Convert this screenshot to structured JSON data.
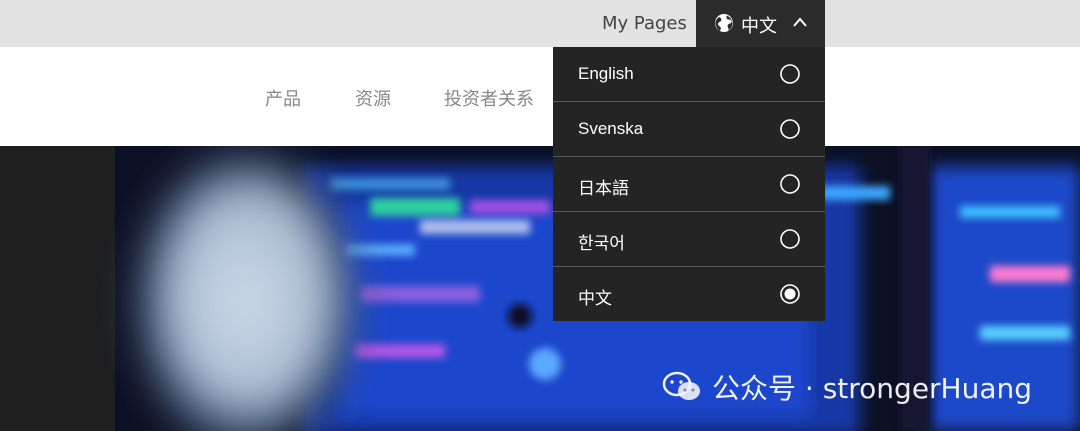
{
  "topbar": {
    "my_pages": "My Pages",
    "language_current": "中文"
  },
  "nav": {
    "items": [
      "产品",
      "资源",
      "投资者关系"
    ]
  },
  "language_menu": {
    "items": [
      {
        "label": "English",
        "selected": false
      },
      {
        "label": "Svenska",
        "selected": false
      },
      {
        "label": "日本語",
        "selected": false
      },
      {
        "label": "한국어",
        "selected": false
      },
      {
        "label": "中文",
        "selected": true
      }
    ]
  },
  "watermark": {
    "text": "公众号 · strongerHuang"
  },
  "colors": {
    "topbar_bg": "#e2e2e2",
    "lang_button_bg": "#2b2b2b",
    "menu_bg": "#242424",
    "hero_blue": "#1a46c8"
  }
}
